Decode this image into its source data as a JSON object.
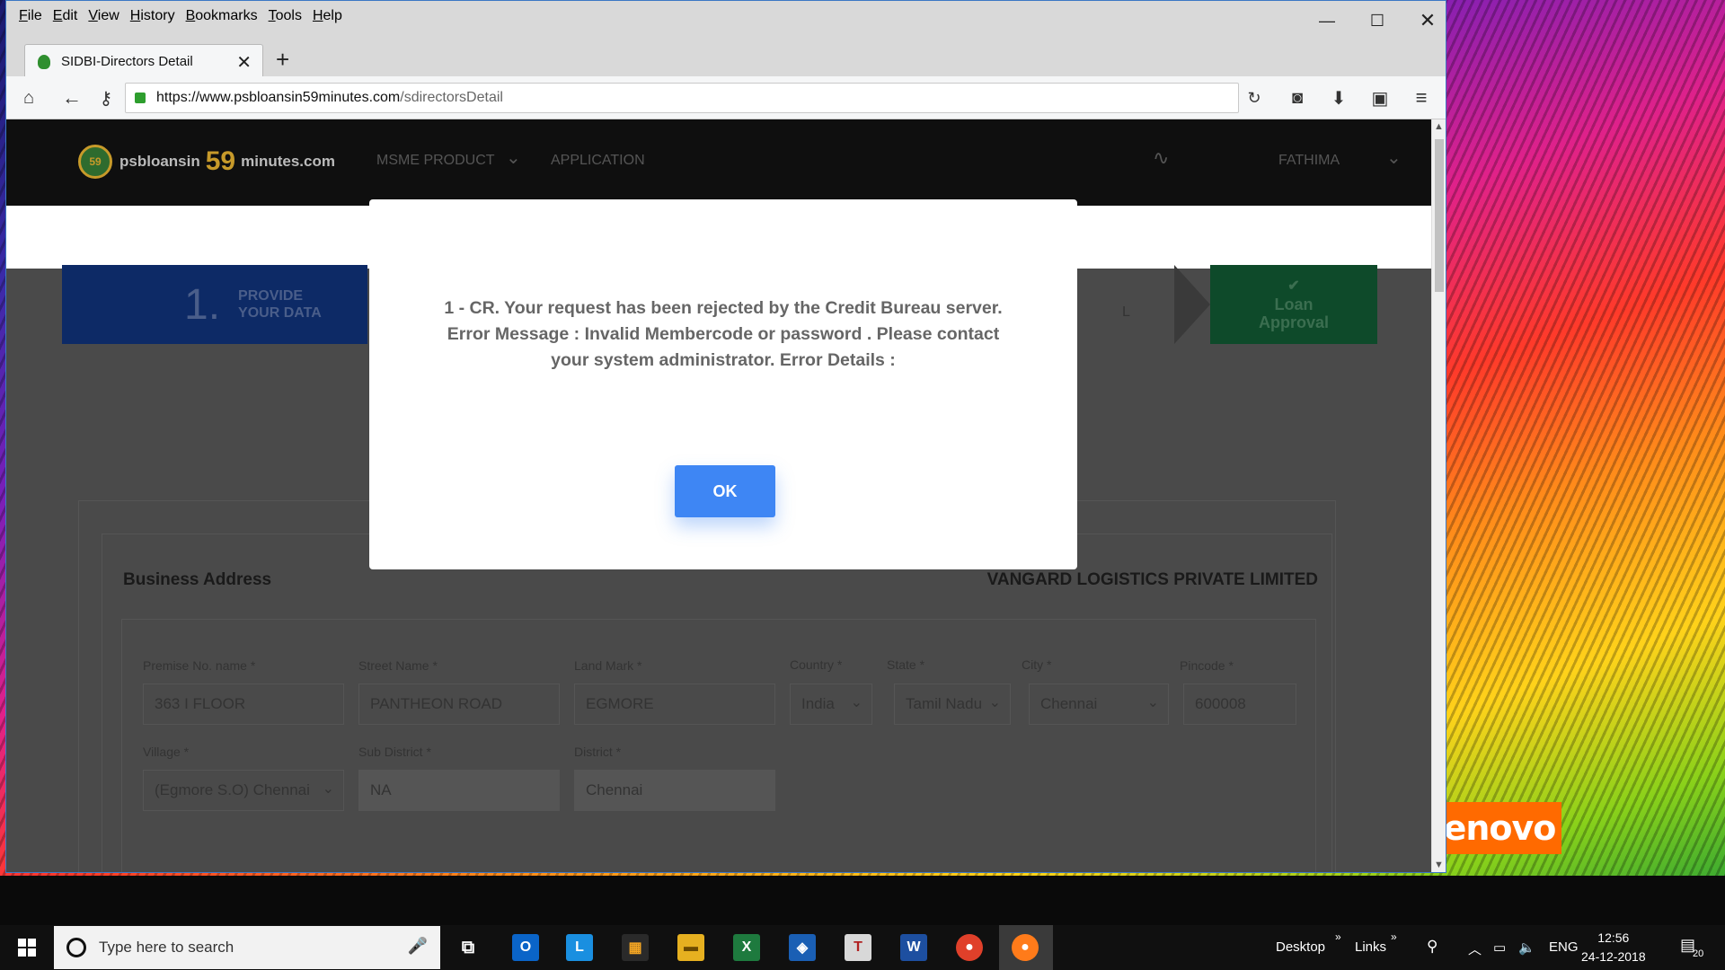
{
  "browser": {
    "menu": [
      "File",
      "Edit",
      "View",
      "History",
      "Bookmarks",
      "Tools",
      "Help"
    ],
    "tab_title": "SIDBI-Directors Detail",
    "url_host": "https://www.psbloansin59minutes.com",
    "url_path": "/sdirectorsDetail"
  },
  "site": {
    "logo_left": "psbloansin",
    "logo_num": "59",
    "logo_right": "minutes.com",
    "badge": "59",
    "nav_product": "MSME PRODUCT",
    "nav_application": "APPLICATION",
    "user": "FATHIMA"
  },
  "stepper": {
    "step1_number": "1.",
    "step1_line1": "PROVIDE",
    "step1_line2": "YOUR DATA",
    "mid_fragment": "L",
    "final_line1": "Loan",
    "final_line2": "Approval"
  },
  "form": {
    "title": "Business Address",
    "company": "VANGARD LOGISTICS PRIVATE LIMITED",
    "premise_label": "Premise No. name *",
    "premise_value": "363 I FLOOR",
    "street_label": "Street Name *",
    "street_value": "PANTHEON ROAD",
    "landmark_label": "Land Mark *",
    "landmark_value": "EGMORE",
    "country_label": "Country *",
    "country_value": "India",
    "state_label": "State *",
    "state_value": "Tamil Nadu",
    "city_label": "City *",
    "city_value": "Chennai",
    "pincode_label": "Pincode *",
    "pincode_value": "600008",
    "village_label": "Village *",
    "village_value": "(Egmore S.O) Chennai",
    "subdistrict_label": "Sub District *",
    "subdistrict_value": "NA",
    "district_label": "District *",
    "district_value": "Chennai"
  },
  "modal": {
    "line1": "1 - CR. Your request has been rejected by the Credit Bureau server.",
    "line2": "Error Message : Invalid Membercode or password . Please contact",
    "line3": "your system administrator. Error Details :",
    "ok_label": "OK"
  },
  "desktop": {
    "brand": "enovo"
  },
  "taskbar": {
    "search_placeholder": "Type here to search",
    "desktop_label": "Desktop",
    "links_label": "Links",
    "lang": "ENG",
    "time": "12:56",
    "date": "24-12-2018",
    "notifications": "20"
  },
  "colors": {
    "accent_button": "#3e86f4",
    "step_blue": "#0d2a66",
    "step_green": "#0e4a2a",
    "lenovo_orange": "#ff6a00"
  }
}
